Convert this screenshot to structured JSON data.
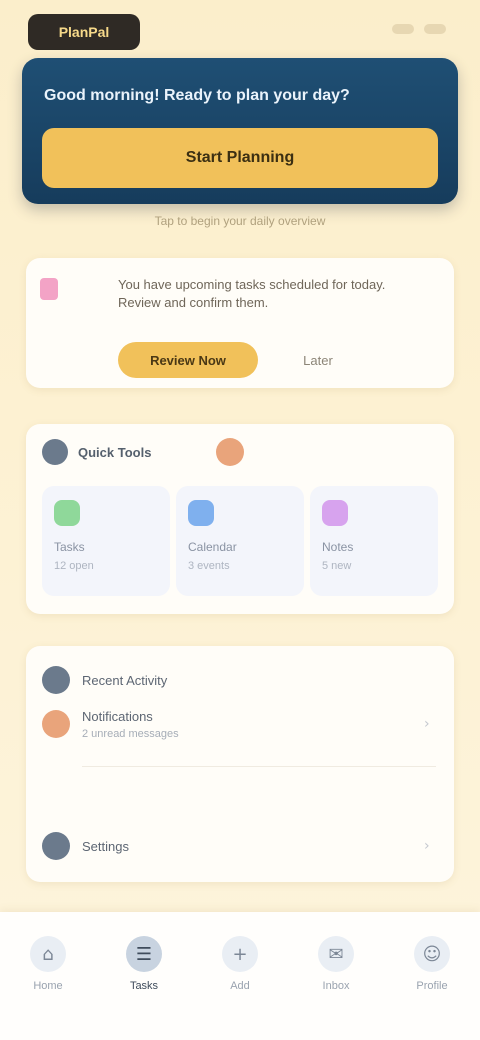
{
  "app": {
    "brand": "PlanPal"
  },
  "hero": {
    "title": "Good morning! Ready to plan your day?",
    "cta_label": "Start Planning",
    "caption": "Tap to begin your daily overview"
  },
  "reminder": {
    "text": "You have upcoming tasks scheduled for today. Review and confirm them.",
    "primary_label": "Review Now",
    "secondary_label": "Later"
  },
  "tools": {
    "title": "Quick Tools",
    "items": [
      {
        "label": "Tasks",
        "sub": "12 open",
        "color": "#8fd89a"
      },
      {
        "label": "Calendar",
        "sub": "3 events",
        "color": "#7fb0ee"
      },
      {
        "label": "Notes",
        "sub": "5 new",
        "color": "#d7a3ee"
      }
    ]
  },
  "list": {
    "items": [
      {
        "label": "Recent Activity",
        "sub": "",
        "color": "#6b7a8c"
      },
      {
        "label": "Notifications",
        "sub": "2 unread messages",
        "color": "#e9a47b"
      },
      {
        "label": "Settings",
        "sub": "",
        "color": "#6b7a8c"
      }
    ]
  },
  "nav": {
    "items": [
      {
        "label": "Home",
        "icon": "home-icon",
        "glyph": "⌂"
      },
      {
        "label": "Tasks",
        "icon": "list-icon",
        "glyph": "☰"
      },
      {
        "label": "Add",
        "icon": "plus-icon",
        "glyph": "+"
      },
      {
        "label": "Inbox",
        "icon": "inbox-icon",
        "glyph": "✉"
      },
      {
        "label": "Profile",
        "icon": "user-icon",
        "glyph": "☺"
      }
    ]
  }
}
